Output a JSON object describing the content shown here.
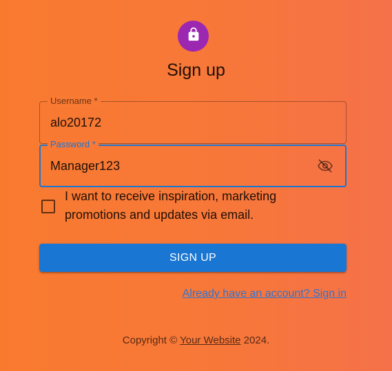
{
  "page": {
    "title": "Sign up"
  },
  "avatar": {
    "icon": "lock-icon",
    "color": "#9c27b0"
  },
  "form": {
    "username": {
      "label": "Username *",
      "value": "alo20172"
    },
    "password": {
      "label": "Password *",
      "value": "Manager123",
      "visibility_icon": "visibility-off-icon"
    },
    "marketing_checkbox": {
      "label": "I want to receive inspiration, marketing promotions and updates via email.",
      "checked": false
    },
    "submit_label": "SIGN UP",
    "signin_link": "Already have an account? Sign in"
  },
  "footer": {
    "prefix": "Copyright ©",
    "link": "Your Website",
    "suffix": "2024."
  },
  "colors": {
    "accent": "#1976d2",
    "background_start": "#f97a2f",
    "background_end": "#f5714a"
  }
}
